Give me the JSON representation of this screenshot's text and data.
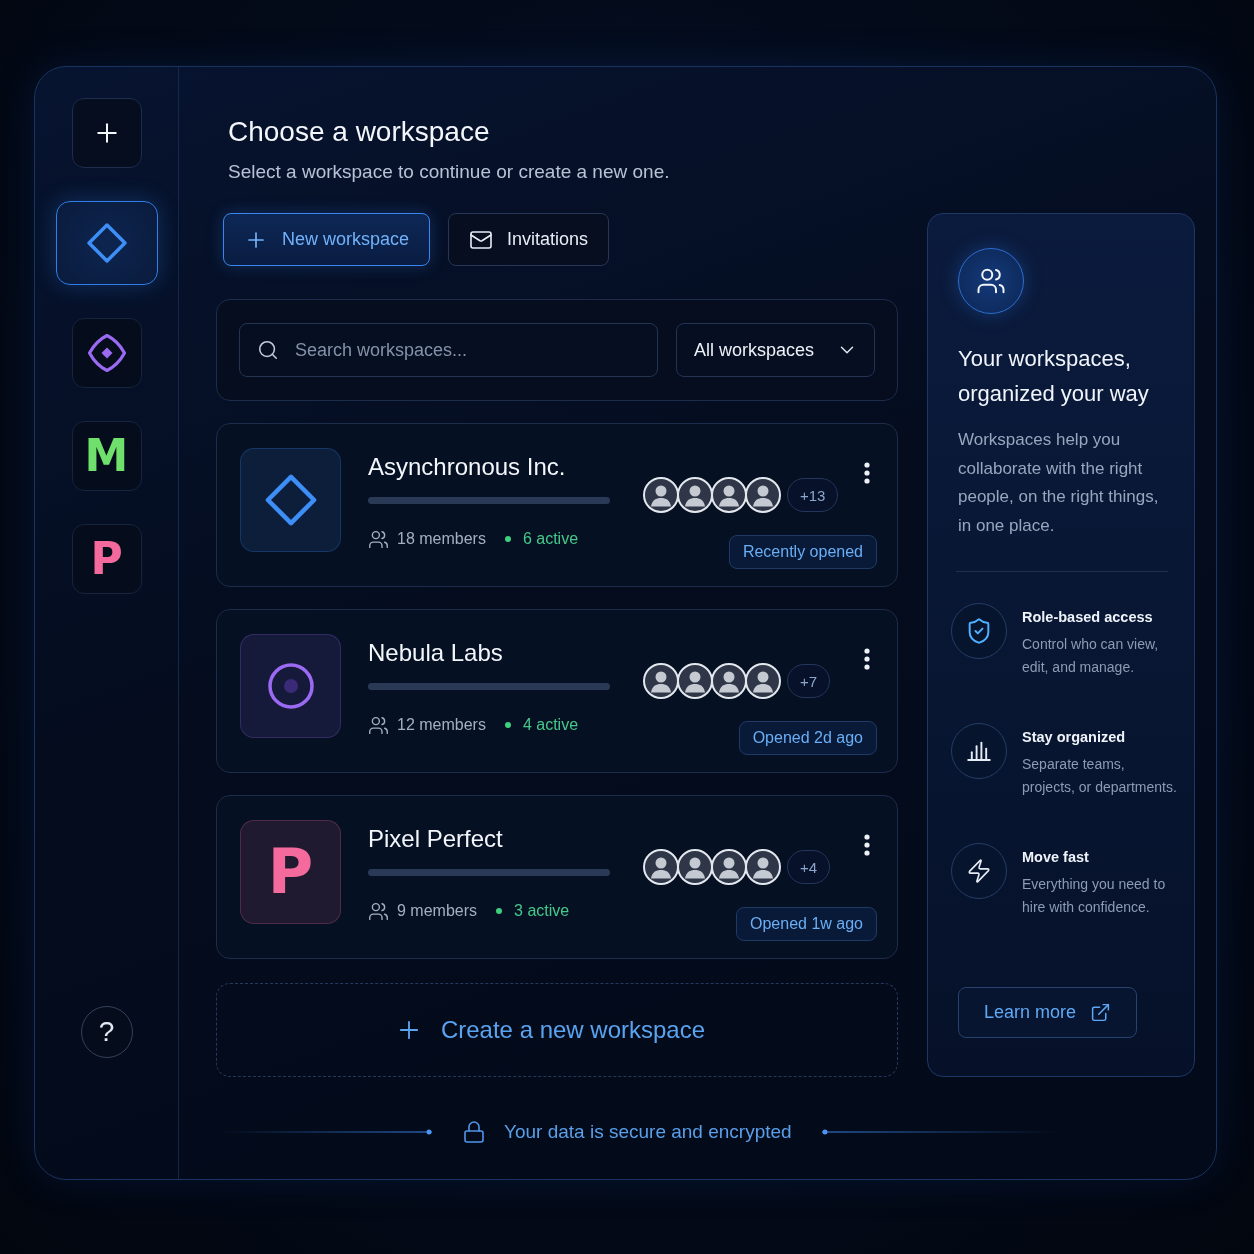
{
  "sidebar": {
    "items": [
      {
        "kind": "add"
      },
      {
        "kind": "diamond",
        "color": "#3d8ef7",
        "selected": true
      },
      {
        "kind": "compass",
        "color": "#9a6af2",
        "selected": false
      },
      {
        "kind": "letter",
        "letter": "M",
        "color": "#6fe06b",
        "selected": false
      },
      {
        "kind": "letter",
        "letter": "P",
        "color": "#f56a9c",
        "selected": false
      }
    ],
    "help": "?"
  },
  "header": {
    "title": "Choose a workspace",
    "subtitle": "Select a workspace to continue or create a new one."
  },
  "actions": [
    {
      "kind": "primary",
      "label": "New workspace"
    },
    {
      "kind": "secondary",
      "label": "Invitations"
    }
  ],
  "filters": {
    "search": {
      "placeholder": "Search workspaces..."
    },
    "scope": {
      "value": "All workspaces"
    }
  },
  "workspaces": [
    {
      "kind": "diamond",
      "name": "Asynchronous Inc.",
      "color": "#3d8ef7",
      "members": "18 members",
      "active": "6 active",
      "avatars": [
        {
          "kind": "silhouette"
        },
        {
          "kind": "silhouette"
        },
        {
          "kind": "silhouette"
        },
        {
          "kind": "silhouette"
        }
      ],
      "more": "+13",
      "opened": "Recently opened"
    },
    {
      "kind": "ring",
      "name": "Nebula Labs",
      "color": "#9a6af2",
      "members": "12 members",
      "active": "4 active",
      "avatars": [
        {
          "kind": "silhouette"
        },
        {
          "kind": "silhouette"
        },
        {
          "kind": "silhouette"
        },
        {
          "kind": "silhouette"
        }
      ],
      "more": "+7",
      "opened": "Opened 2d ago"
    },
    {
      "kind": "letter",
      "letter": "P",
      "name": "Pixel Perfect",
      "color": "#f56a9c",
      "members": "9 members",
      "active": "3 active",
      "avatars": [
        {
          "kind": "silhouette"
        },
        {
          "kind": "silhouette"
        },
        {
          "kind": "silhouette"
        },
        {
          "kind": "silhouette"
        }
      ],
      "more": "+4",
      "opened": "Opened 1w ago"
    }
  ],
  "create": {
    "label": "Create a new workspace"
  },
  "footer": {
    "text": "Your data is secure and encrypted"
  },
  "info": {
    "title": "Your workspaces, organized your way",
    "body": "Workspaces help you collaborate with the right people, on the right things, in one place.",
    "features": [
      {
        "kind": "shield",
        "title": "Role-based access",
        "text": "Control who can view,\nedit, and manage."
      },
      {
        "kind": "chart",
        "title": "Stay organized",
        "text": "Separate teams,\nprojects, or departments."
      },
      {
        "kind": "bolt",
        "title": "Move fast",
        "text": "Everything you need to\nhire with confidence."
      }
    ],
    "link": "Learn more"
  }
}
